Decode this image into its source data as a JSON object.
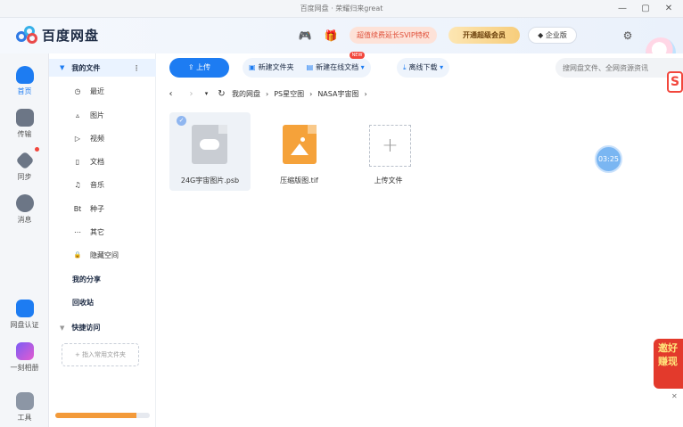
{
  "window": {
    "title": "百度网盘 · 荣耀归来great"
  },
  "header": {
    "logo_text": "百度网盘",
    "svip_label": "超值续费延长SVIP特权",
    "vip_label": "开通超级会员",
    "enterprise_label": "企业版"
  },
  "rail": {
    "items": [
      {
        "label": "首页"
      },
      {
        "label": "传输"
      },
      {
        "label": "同步"
      },
      {
        "label": "消息"
      },
      {
        "label": "网盘认证"
      },
      {
        "label": "一刻相册"
      },
      {
        "label": "工具"
      }
    ]
  },
  "sidebar": {
    "my_files": "我的文件",
    "items": [
      {
        "label": "最近",
        "icon": "◷"
      },
      {
        "label": "图片",
        "icon": "▵"
      },
      {
        "label": "视频",
        "icon": "▷"
      },
      {
        "label": "文档",
        "icon": "▯"
      },
      {
        "label": "音乐",
        "icon": "♫"
      },
      {
        "label": "种子",
        "icon": "Bt"
      },
      {
        "label": "其它",
        "icon": "⋯"
      },
      {
        "label": "隐藏空间",
        "icon": "🔒"
      }
    ],
    "my_share": "我的分享",
    "recycle": "回收站",
    "quick_access": "快捷访问",
    "pin_folder": "+ 指入常用文件夹",
    "storage_used_fraction": 0.86
  },
  "toolbar": {
    "upload": "上传",
    "new_folder": "新建文件夹",
    "new_doc": "新建在线文档",
    "new_badge": "NEW",
    "offline_download": "离线下载",
    "search_placeholder": "搜网盘文件、全网资源资讯"
  },
  "breadcrumb": {
    "items": [
      "我的网盘",
      "PS星空图",
      "NASA宇宙图"
    ]
  },
  "files": [
    {
      "name": "24G宇宙图片.psb",
      "type": "psb",
      "selected": true
    },
    {
      "name": "压缩版图.tif",
      "type": "tif",
      "selected": false
    },
    {
      "name": "上传文件",
      "type": "upload",
      "selected": false
    }
  ],
  "overlay": {
    "timer": "03:25",
    "promo_text": "邀好\n赚现"
  },
  "colors": {
    "accent": "#1d7cf2",
    "storage": "#f39a3a",
    "promo": "#e33a2c"
  }
}
